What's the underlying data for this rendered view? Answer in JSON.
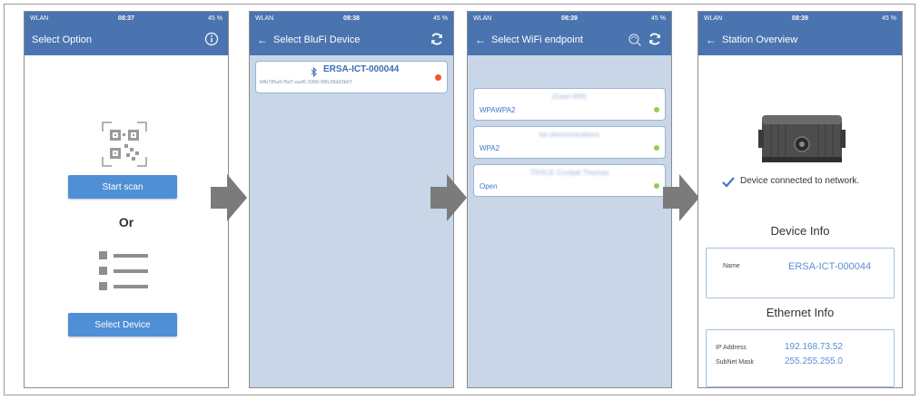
{
  "colors": {
    "appbar": "#4a74b0",
    "button": "#4f8fd6",
    "list_bg": "#c8d6e8",
    "arrow": "#7b7b7b",
    "dot_green": "#8fd14f",
    "dot_red": "#ef5a22",
    "value_blue": "#5b8fd2"
  },
  "screens": [
    {
      "status": {
        "left": "WLAN",
        "time": "08:37",
        "right": "45 %"
      },
      "title": "Select Option",
      "right_icon": "info-icon",
      "start_scan": "Start scan",
      "or": "Or",
      "select_device": "Select Device"
    },
    {
      "status": {
        "left": "WLAN",
        "time": "08:38",
        "right": "45 %"
      },
      "title": "Select BluFi Device",
      "right_icon": "refresh-icon",
      "device_name": "ERSA-ICT-000044",
      "device_id": "b8b785a5-f5d7-aa45-3390-5f8c28d33b67"
    },
    {
      "status": {
        "left": "WLAN",
        "time": "08:39",
        "right": "45 %"
      },
      "title": "Select WiFi endpoint",
      "right_icons": [
        "search-wifi-icon",
        "refresh-icon"
      ],
      "networks": [
        {
          "ssid": "(Gast-Wifi)",
          "security": "WPAWPA2"
        },
        {
          "ssid": "be-demonstrations",
          "security": "WPA2"
        },
        {
          "ssid": "TRACE Cockpit Thomas",
          "security": "Open"
        }
      ]
    },
    {
      "status": {
        "left": "WLAN",
        "time": "08:39",
        "right": "45 %"
      },
      "title": "Station Overview",
      "connected_msg": "Device connected to network.",
      "device_info_title": "Device Info",
      "name_label": "Name",
      "name_value": "ERSA-ICT-000044",
      "ethernet_info_title": "Ethernet Info",
      "ip_label": "IP Address",
      "ip_value": "192.168.73.52",
      "subnet_label": "SubNet Mask",
      "subnet_value": "255.255.255.0"
    }
  ]
}
